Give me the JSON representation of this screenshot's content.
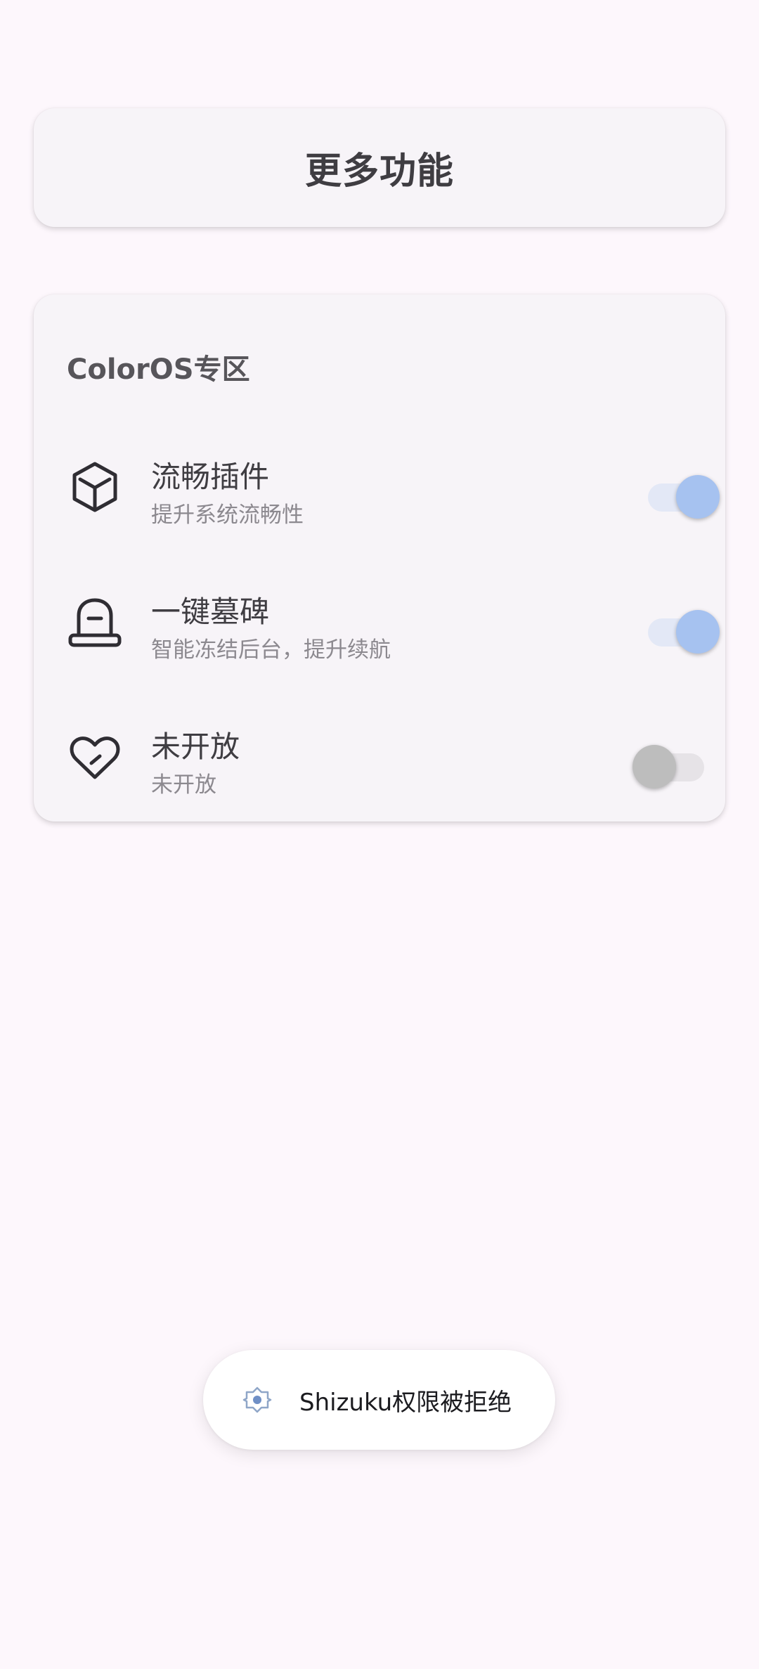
{
  "header": {
    "title": "更多功能"
  },
  "section": {
    "title": "ColorOS专区",
    "items": [
      {
        "icon": "cube-icon",
        "title": "流畅插件",
        "subtitle": "提升系统流畅性",
        "enabled": true
      },
      {
        "icon": "tombstone-icon",
        "title": "一键墓碑",
        "subtitle": "智能冻结后台，提升续航",
        "enabled": true
      },
      {
        "icon": "heart-icon",
        "title": "未开放",
        "subtitle": "未开放",
        "enabled": false
      }
    ]
  },
  "toast": {
    "icon": "shizuku-icon",
    "text": "Shizuku权限被拒绝"
  },
  "colors": {
    "background": "#fdf7fc",
    "card": "#f7f4f8",
    "toggle_on_thumb": "#a6c2f0",
    "toggle_on_track": "#e3e8f6",
    "toggle_off_thumb": "#bdbdbd",
    "toggle_off_track": "#e6e3e7"
  }
}
